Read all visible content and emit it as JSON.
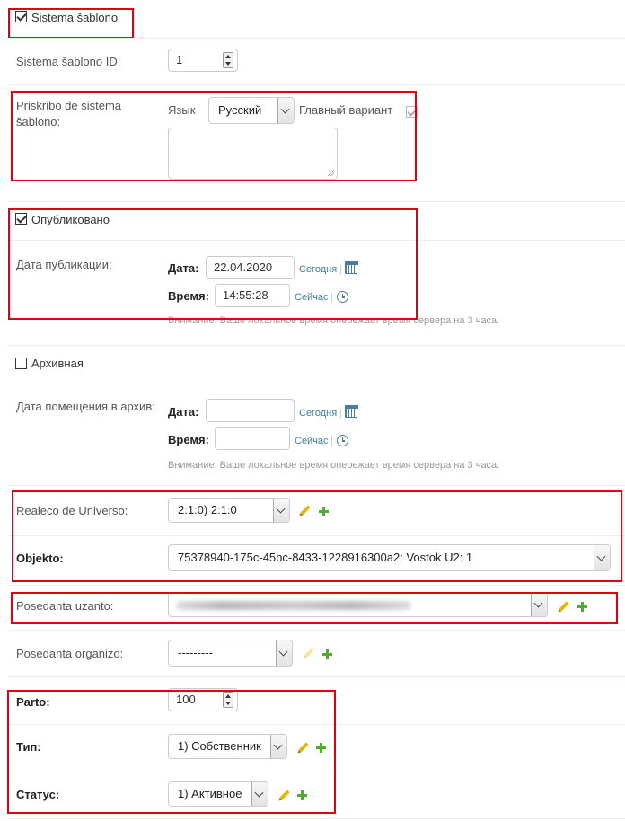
{
  "sistema_sablono": {
    "checkbox_label": "Sistema šablono",
    "checked": true,
    "id_label": "Sistema šablono ID:",
    "id_value": "1"
  },
  "priskribo": {
    "label": "Priskribo de sistema šablono:",
    "language_label": "Язык",
    "language_value": "Русский",
    "main_variant_label": "Главный вариант",
    "textarea_value": ""
  },
  "publikovano": {
    "checkbox_label": "Опубликовано",
    "checked": true,
    "date_label": "Дата публикации:",
    "date_field_label": "Дата:",
    "date_value": "22.04.2020",
    "today_link": "Сегодня",
    "time_field_label": "Время:",
    "time_value": "14:55:28",
    "now_link": "Сейчас",
    "help": "Внимание: Ваше локальное время опережает время сервера на 3 часа."
  },
  "arhiv": {
    "checkbox_label": "Архивная",
    "checked": false,
    "date_label": "Дата помещения в архив:",
    "date_field_label": "Дата:",
    "date_value": "",
    "today_link": "Сегодня",
    "time_field_label": "Время:",
    "time_value": "",
    "now_link": "Сейчас",
    "help": "Внимание: Ваше локальное время опережает время сервера на 3 часа."
  },
  "realeco": {
    "label": "Realeco de Universo:",
    "value": "2:1:0) 2:1:0"
  },
  "objekto": {
    "label": "Objekto:",
    "value": "75378940-175c-45bc-8433-1228916300a2: Vostok U2: 1"
  },
  "posedanta_uzanto": {
    "label": "Posedanta uzanto:",
    "value": ""
  },
  "posedanta_organizo": {
    "label": "Posedanta organizo:",
    "value": "---------"
  },
  "parto": {
    "label": "Parto:",
    "value": "100"
  },
  "tip": {
    "label": "Тип:",
    "value": "1) Собственник"
  },
  "status": {
    "label": "Статус:",
    "value": "1) Активное"
  },
  "colors": {
    "highlight": "#e0000e",
    "link": "#447e9b",
    "add": "#4dae2c",
    "change": "#e3b70d"
  }
}
